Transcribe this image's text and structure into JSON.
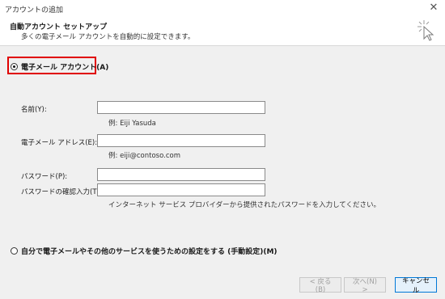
{
  "window": {
    "title": "アカウントの追加"
  },
  "header": {
    "title": "自動アカウント セットアップ",
    "subtitle": "多くの電子メール アカウントを自動的に設定できます。"
  },
  "options": {
    "email_account": {
      "label": "電子メール アカウント(A)",
      "selected": true
    },
    "manual_setup": {
      "label": "自分で電子メールやその他のサービスを使うための設定をする (手動設定)(M)",
      "selected": false
    }
  },
  "form": {
    "name_label": "名前(Y):",
    "name_value": "",
    "name_hint": "例: Eiji Yasuda",
    "email_label": "電子メール アドレス(E):",
    "email_value": "",
    "email_hint": "例: eiji@contoso.com",
    "password_label": "パスワード(P):",
    "password_confirm_label": "パスワードの確認入力(T):",
    "password_hint": "インターネット サービス プロバイダーから提供されたパスワードを入力してください。"
  },
  "buttons": {
    "back": "< 戻る(B)",
    "next": "次へ(N) >",
    "cancel": "キャンセル"
  },
  "colors": {
    "highlight": "#e00000",
    "accent": "#0078d7"
  }
}
